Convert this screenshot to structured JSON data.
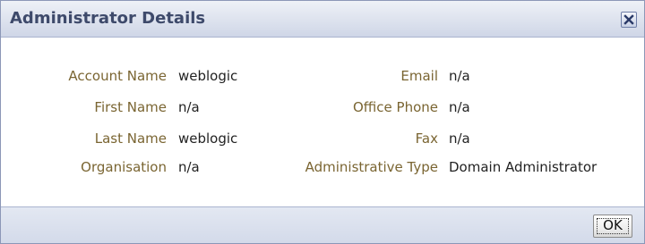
{
  "dialog": {
    "title": "Administrator Details",
    "close_icon": "close-x-icon",
    "ok_label": "OK"
  },
  "details": {
    "account_name": {
      "label": "Account Name",
      "value": "weblogic"
    },
    "first_name": {
      "label": "First Name",
      "value": "n/a"
    },
    "last_name": {
      "label": "Last Name",
      "value": "weblogic"
    },
    "organisation": {
      "label": "Organisation",
      "value": "n/a"
    },
    "email": {
      "label": "Email",
      "value": "n/a"
    },
    "office_phone": {
      "label": "Office Phone",
      "value": "n/a"
    },
    "fax": {
      "label": "Fax",
      "value": "n/a"
    },
    "administrative_type": {
      "label": "Administrative Type",
      "value": "Domain Administrator"
    }
  },
  "colors": {
    "label_text": "#7a6532",
    "value_text": "#222222",
    "title_text": "#3e4a6b",
    "border": "#8c97b7"
  }
}
